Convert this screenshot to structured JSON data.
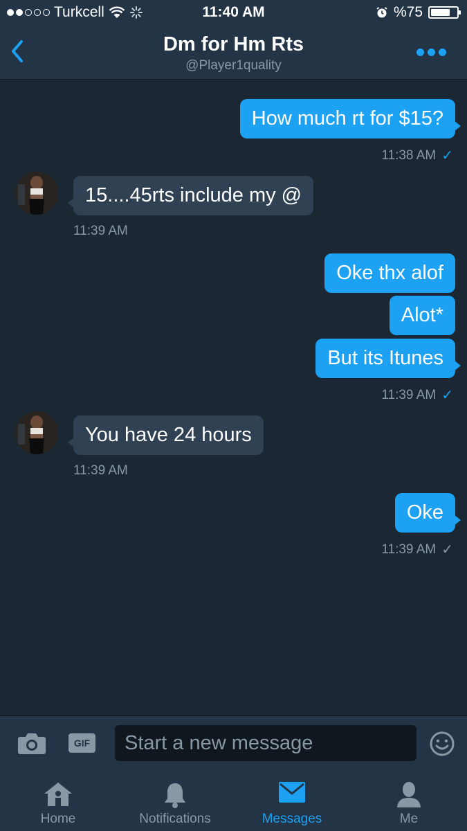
{
  "status_bar": {
    "carrier": "Turkcell",
    "time": "11:40 AM",
    "battery_text": "%75",
    "battery_level": 0.75,
    "signal_bars_filled": 2,
    "signal_bars_total": 5
  },
  "header": {
    "title": "Dm for Hm Rts",
    "subtitle": "@Player1quality",
    "back_icon": "chevron-left-icon",
    "more_icon": "more-dots-icon"
  },
  "messages": [
    {
      "text": "How much rt for $15?"
    },
    {
      "text": "11:38 AM"
    },
    {
      "text": "15....45rts include my @"
    },
    {
      "text": "11:39 AM"
    },
    {
      "text": "Oke thx alof"
    },
    {
      "text": "Alot*"
    },
    {
      "text": "But its Itunes"
    },
    {
      "text": "11:39 AM"
    },
    {
      "text": "You have 24 hours"
    },
    {
      "text": "11:39 AM"
    },
    {
      "text": "Oke"
    },
    {
      "text": "11:39 AM"
    }
  ],
  "composer": {
    "gif_label": "GIF",
    "placeholder": "Start a new message",
    "value": ""
  },
  "tabs": [
    {
      "label": "Home",
      "icon": "home-icon"
    },
    {
      "label": "Notifications",
      "icon": "bell-icon"
    },
    {
      "label": "Messages",
      "icon": "envelope-icon",
      "active": true
    },
    {
      "label": "Me",
      "icon": "person-icon"
    }
  ],
  "colors": {
    "background": "#1b2733",
    "bar": "#243447",
    "accent": "#1da1f2",
    "incoming_bubble": "#304153",
    "muted": "#8899a6"
  }
}
